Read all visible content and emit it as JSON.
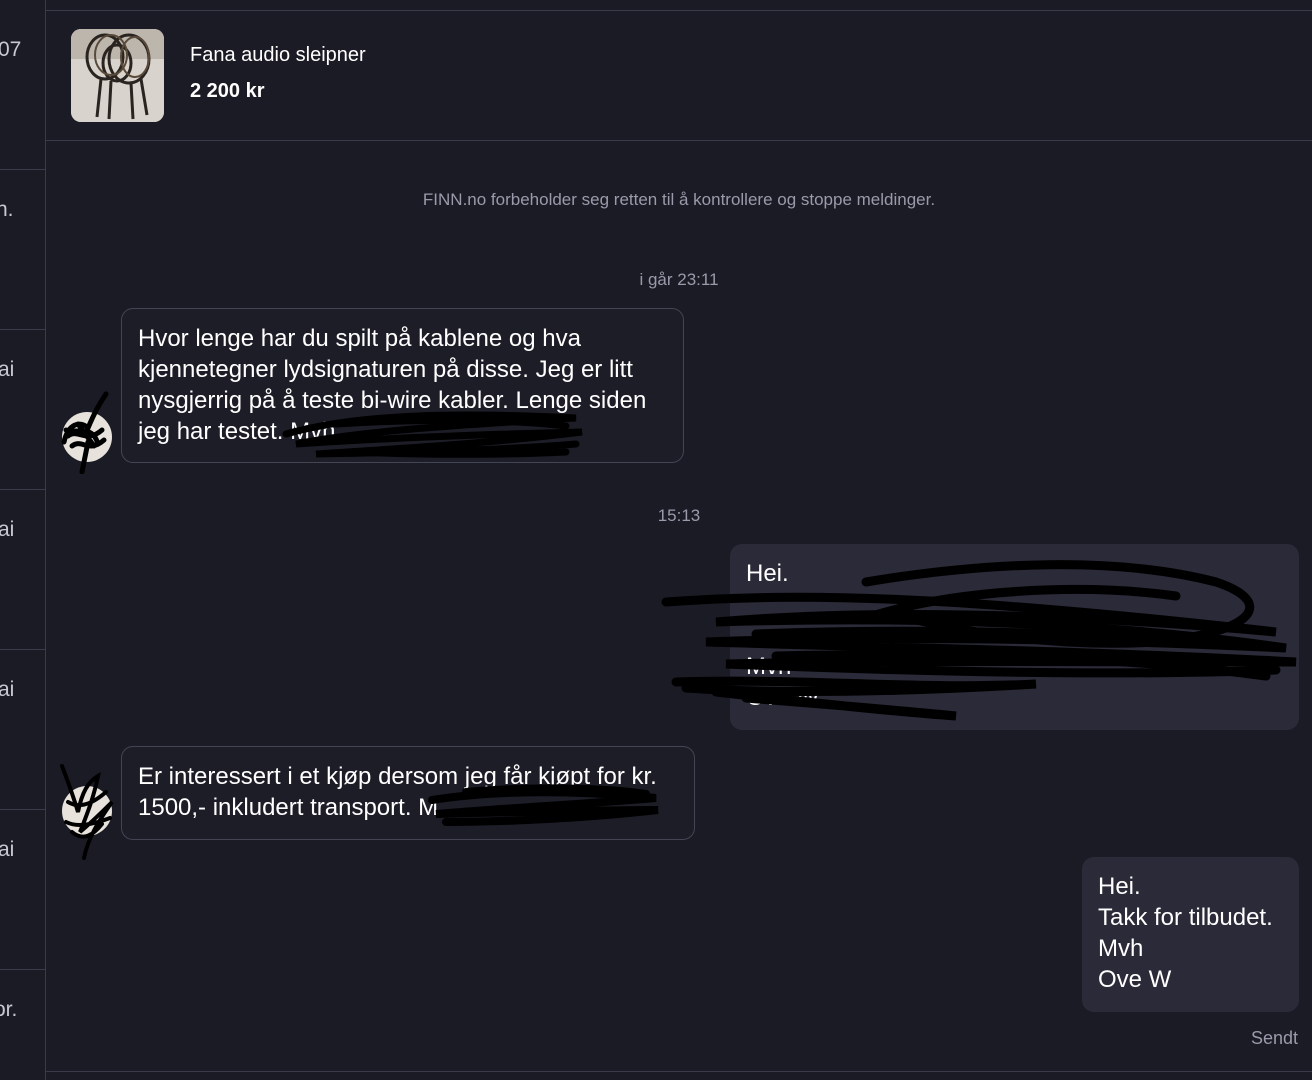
{
  "sidebar": {
    "items": [
      {
        "snippet": "07"
      },
      {
        "snippet": "n."
      },
      {
        "snippet": "ai"
      },
      {
        "snippet": "ai"
      },
      {
        "snippet": "ai"
      },
      {
        "snippet": "ai"
      },
      {
        "snippet": "or."
      }
    ]
  },
  "listing": {
    "title": "Fana audio sleipner",
    "price": "2 200 kr"
  },
  "notice": "FINN.no forbeholder seg retten til å kontrollere og stoppe meldinger.",
  "messages": [
    {
      "timestamp": "i går 23:11",
      "direction": "incoming",
      "lines": [
        "Hvor lenge har du spilt på kablene og hva",
        "kjennetegner lydsignaturen på disse. Jeg er litt",
        "nysgjerrig på å teste bi-wire kabler. Lenge siden",
        "jeg har testet. Mvh"
      ]
    },
    {
      "timestamp": "15:13",
      "direction": "outgoing",
      "lines": [
        "Hei.",
        "",
        "",
        "Mvh",
        "Ove W"
      ]
    },
    {
      "direction": "incoming",
      "lines": [
        "Er interessert i et kjøp dersom jeg får kjøpt for kr.",
        "1500,- inkludert transport. M"
      ]
    },
    {
      "direction": "outgoing",
      "lines": [
        "Hei.",
        "Takk for tilbudet.",
        "Mvh",
        "Ove W"
      ]
    }
  ],
  "status_label": "Sendt",
  "colors": {
    "background": "#1b1b25",
    "bubble_out": "#2a2a38",
    "bubble_in_border": "#444454",
    "muted_text": "#9a9aab",
    "divider": "#3a3a48"
  },
  "icons": {
    "listing_thumbnail": "cable-photo",
    "avatar": "user-avatar"
  }
}
